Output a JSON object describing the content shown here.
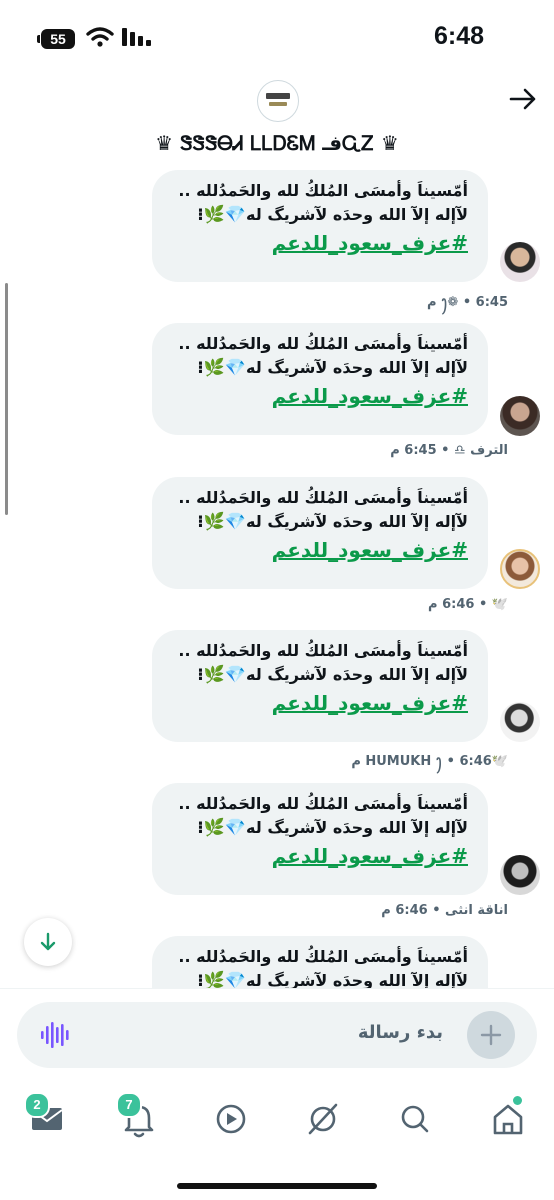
{
  "status_bar": {
    "time": "6:48",
    "battery": "55"
  },
  "header": {
    "title": "♛ ᏩᏃفـ ᏕᏕᏕᎾᏗ ᏞᏞᎠᏋᎷ ♛"
  },
  "messages": [
    {
      "line1": "أمّسيناَ وأمسَى المُلكُ لله والحَمدُلله ..",
      "line2": "لآإله إلآ الله وحدَه لآشريگ له",
      "emoji": "💎🌿⁝",
      "hashtag": "#عزف_سعود_للدعم",
      "meta": "ꫂ❁ • 6:45 م"
    },
    {
      "line1": "أمّسيناَ وأمسَى المُلكُ لله والحَمدُلله ..",
      "line2": "لآإله إلآ الله وحدَه لآشريگ له",
      "emoji": "💎🌿⁝",
      "hashtag": "#عزف_سعود_للدعم",
      "meta": "الترف ♎︎ • 6:45 م"
    },
    {
      "line1": "أمّسيناَ وأمسَى المُلكُ لله والحَمدُلله ..",
      "line2": "لآإله إلآ الله وحدَه لآشريگ له",
      "emoji": "💎🌿⁝",
      "hashtag": "#عزف_سعود_للدعم",
      "meta": "🕊️ • 6:46 م"
    },
    {
      "line1": "أمّسيناَ وأمسَى المُلكُ لله والحَمدُلله ..",
      "line2": "لآإله إلآ الله وحدَه لآشريگ له",
      "emoji": "💎🌿⁝",
      "hashtag": "#عزف_سعود_للدعم",
      "meta": "🕊️HUMUKH ꫂ • 6:46 م"
    },
    {
      "line1": "أمّسيناَ وأمسَى المُلكُ لله والحَمدُلله ..",
      "line2": "لآإله إلآ الله وحدَه لآشريگ له",
      "emoji": "💎🌿⁝",
      "hashtag": "#عزف_سعود_للدعم",
      "meta": "اناقة انثى • 6:46 م"
    },
    {
      "line1": "أمّسيناَ وأمسَى المُلكُ لله والحَمدُلله ..",
      "line2": "لآإله إلآ الله وحدَه لآشريگ له",
      "emoji": "💎🌿⁝"
    }
  ],
  "composer": {
    "placeholder": "بدء رسالة"
  },
  "bottom_nav": {
    "messages_badge": "2",
    "notifications_badge": "7"
  },
  "colors": {
    "accent": "#3bc29b",
    "hashtag": "#0b9a4a",
    "bubble": "#eff3f4",
    "voice": "#7856ff"
  }
}
